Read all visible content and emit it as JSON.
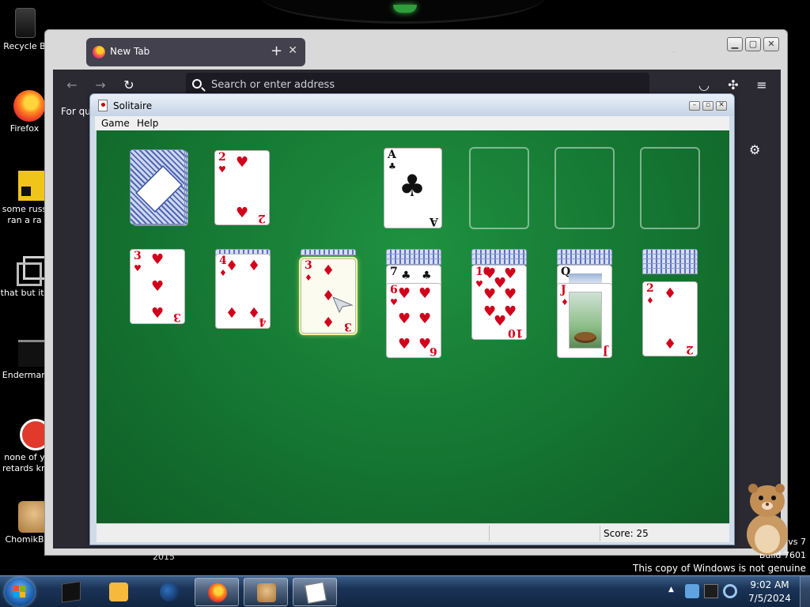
{
  "desktop": {
    "icons": [
      {
        "label": "Recycle B",
        "icon": "recycle-bin-icon"
      },
      {
        "label": "Firefox",
        "icon": "firefox-icon"
      },
      {
        "label": "some russ",
        "label2": "ran a ra",
        "icon": "shortcut-icon"
      },
      {
        "label": "that but its",
        "icon": "folder-icon"
      },
      {
        "label": "Enderman",
        "icon": "app-icon"
      },
      {
        "label": "none of y",
        "label2": "retards kn",
        "icon": "app-icon"
      },
      {
        "label": "ChomikB",
        "icon": "chomikbox-icon"
      }
    ]
  },
  "firefox": {
    "tab_title": "New Tab",
    "url_placeholder": "Search or enter address",
    "shortcuts_text": "For qui",
    "footer_year": "2015"
  },
  "solitaire": {
    "title": "Solitaire",
    "menu": [
      "Game",
      "Help"
    ],
    "score_text": "Score: 25",
    "stock": {
      "face_down": true
    },
    "waste": {
      "rank": "2",
      "suit": "♥",
      "color": "red"
    },
    "foundations": [
      {
        "rank": "A",
        "suit": "♣",
        "color": "black"
      },
      {
        "empty": true
      },
      {
        "empty": true
      },
      {
        "empty": true
      }
    ],
    "tableau": [
      {
        "hidden": 0,
        "face_up": [
          {
            "rank": "3",
            "suit": "♥",
            "color": "red"
          }
        ]
      },
      {
        "hidden": 1,
        "face_up": [
          {
            "rank": "4",
            "suit": "♦",
            "color": "red"
          }
        ]
      },
      {
        "hidden": 1,
        "face_up": [
          {
            "rank": "3",
            "suit": "♦",
            "color": "red",
            "selected": true
          }
        ]
      },
      {
        "hidden": 3,
        "face_up": [
          {
            "rank": "7",
            "suit": "♣",
            "color": "black"
          },
          {
            "rank": "6",
            "suit": "♥",
            "color": "red"
          }
        ]
      },
      {
        "hidden": 3,
        "face_up": [
          {
            "rank": "10",
            "suit": "♥",
            "color": "red"
          }
        ]
      },
      {
        "hidden": 3,
        "face_up": [
          {
            "rank": "Q",
            "suit": "",
            "color": "black"
          },
          {
            "rank": "J",
            "suit": "♦",
            "color": "red"
          }
        ]
      },
      {
        "hidden": 5,
        "face_up": [
          {
            "rank": "2",
            "suit": "♦",
            "color": "red"
          }
        ]
      }
    ]
  },
  "taskbar": {
    "apps": [
      {
        "name": "terminal-icon",
        "active": false
      },
      {
        "name": "media-player-icon",
        "active": false
      },
      {
        "name": "globe-icon",
        "active": false
      },
      {
        "name": "firefox-icon",
        "active": true
      },
      {
        "name": "chomikbox-icon",
        "active": true
      },
      {
        "name": "solitaire-icon",
        "active": true
      }
    ],
    "time": "9:02 AM",
    "date": "7/5/2024"
  },
  "watermark": {
    "line1": "vs 7",
    "line2": "Build 7601",
    "line3": "This copy of Windows is not genuine"
  }
}
